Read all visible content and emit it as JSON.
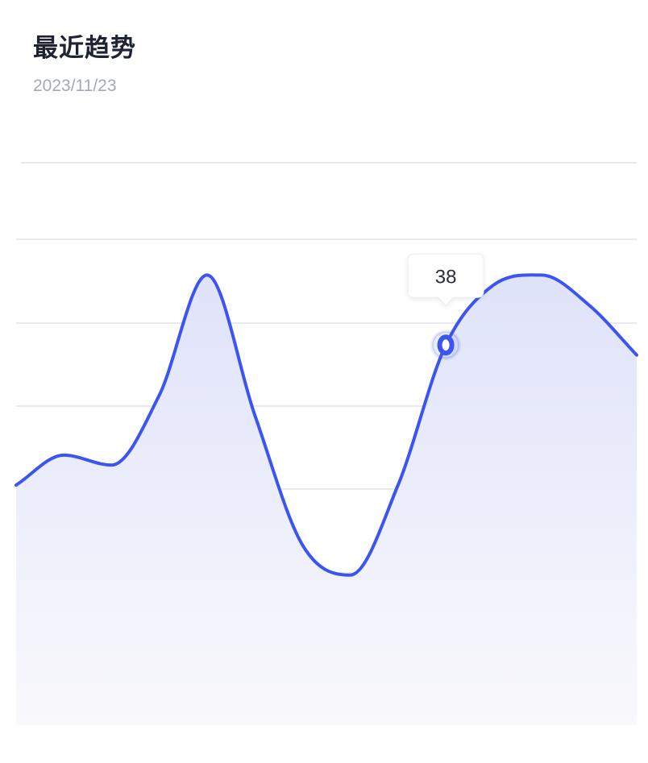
{
  "header": {
    "title": "最近趋势",
    "date": "2023/11/23"
  },
  "colors": {
    "line": "#3d55f0",
    "area_top": "#dfe3fa",
    "area_bottom": "#f9f9fc",
    "grid": "#e9eaee",
    "title": "#1f2233",
    "subtitle": "#a3a9b8",
    "tooltip_bg": "#ffffff",
    "tooltip_border": "#eceef2"
  },
  "chart_data": {
    "type": "area",
    "smooth": true,
    "x": [
      0,
      1,
      2,
      3,
      4,
      5,
      6,
      7,
      8,
      9,
      10,
      11,
      12,
      13
    ],
    "values": [
      24,
      27,
      26,
      33,
      45,
      31,
      18,
      15,
      24,
      38,
      44,
      45,
      42,
      37
    ],
    "ylim": [
      0,
      58
    ],
    "grid": true,
    "tooltip": {
      "index": 9,
      "label": "38"
    }
  }
}
